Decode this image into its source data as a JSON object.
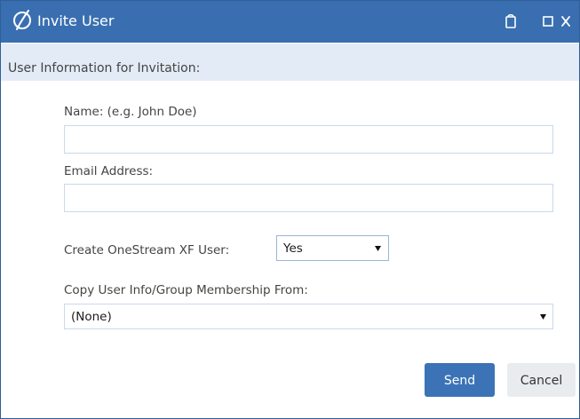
{
  "window": {
    "title": "Invite User",
    "accent_color": "#396fb0",
    "controls": [
      {
        "name": "help-icon"
      },
      {
        "name": "maximize-icon"
      },
      {
        "name": "close-icon"
      }
    ]
  },
  "section": {
    "title": "User Information for Invitation:",
    "background": "#e3ebf6"
  },
  "form": {
    "name": {
      "label": "Name: (e.g. John Doe)",
      "value": "",
      "placeholder": ""
    },
    "email": {
      "label": "Email Address:",
      "value": "",
      "placeholder": ""
    },
    "create_user": {
      "label": "Create OneStream XF User:",
      "selected": "Yes"
    },
    "copy_from": {
      "label": "Copy User Info/Group Membership From:",
      "selected": "(None)"
    }
  },
  "buttons": {
    "send": "Send",
    "cancel": "Cancel",
    "primary_color": "#3b73b6"
  }
}
